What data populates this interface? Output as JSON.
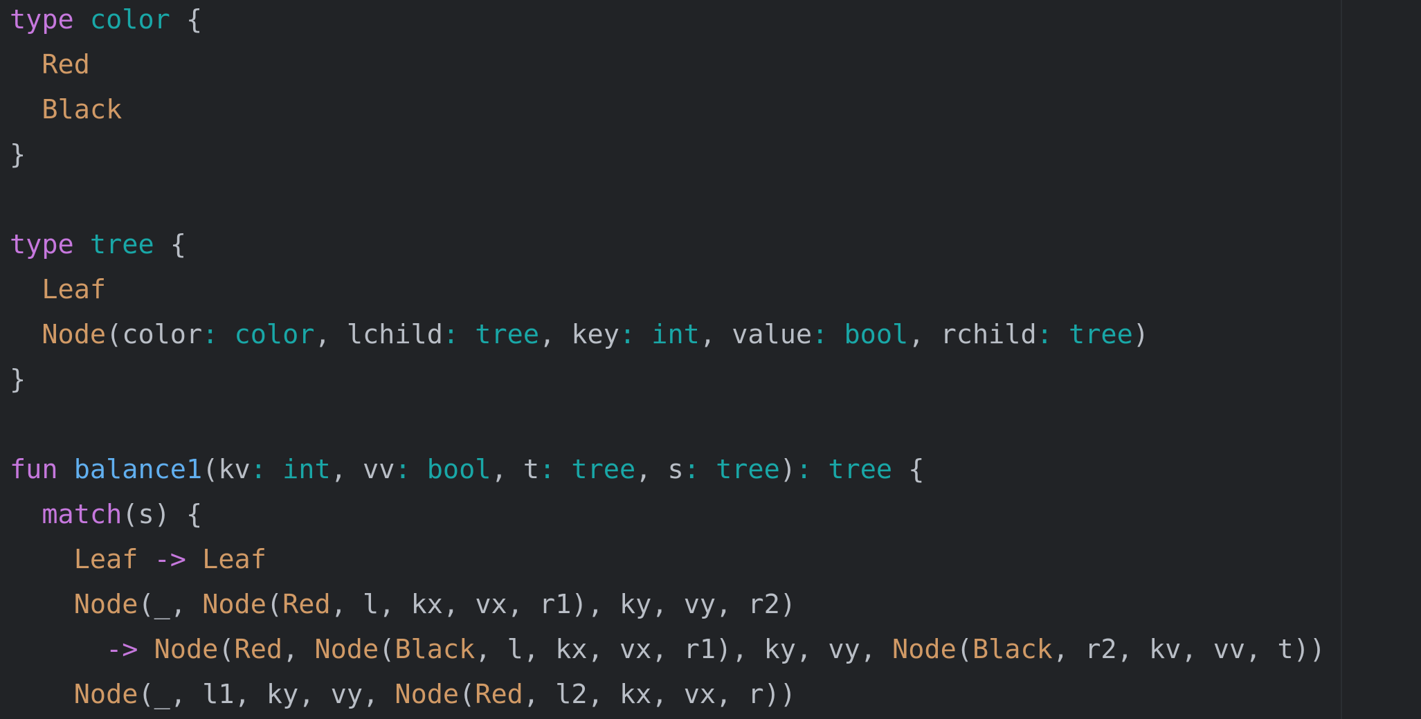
{
  "editor": {
    "colors": {
      "background": "#212326",
      "keyword": "#c678dd",
      "type": "#19a7a7",
      "constructor": "#d19a66",
      "function": "#61afef",
      "identifier": "#b9bec6"
    },
    "lines": [
      [
        [
          "kw",
          "type"
        ],
        [
          "ws",
          " "
        ],
        [
          "type",
          "color"
        ],
        [
          "ws",
          " "
        ],
        [
          "punc",
          "{"
        ]
      ],
      [
        [
          "ws",
          "  "
        ],
        [
          "ctor",
          "Red"
        ]
      ],
      [
        [
          "ws",
          "  "
        ],
        [
          "ctor",
          "Black"
        ]
      ],
      [
        [
          "punc",
          "}"
        ]
      ],
      [],
      [
        [
          "kw",
          "type"
        ],
        [
          "ws",
          " "
        ],
        [
          "type",
          "tree"
        ],
        [
          "ws",
          " "
        ],
        [
          "punc",
          "{"
        ]
      ],
      [
        [
          "ws",
          "  "
        ],
        [
          "ctor",
          "Leaf"
        ]
      ],
      [
        [
          "ws",
          "  "
        ],
        [
          "ctor",
          "Node"
        ],
        [
          "punc",
          "("
        ],
        [
          "id",
          "color"
        ],
        [
          "colon",
          ":"
        ],
        [
          "ws",
          " "
        ],
        [
          "type",
          "color"
        ],
        [
          "punc",
          ","
        ],
        [
          "ws",
          " "
        ],
        [
          "id",
          "lchild"
        ],
        [
          "colon",
          ":"
        ],
        [
          "ws",
          " "
        ],
        [
          "type",
          "tree"
        ],
        [
          "punc",
          ","
        ],
        [
          "ws",
          " "
        ],
        [
          "id",
          "key"
        ],
        [
          "colon",
          ":"
        ],
        [
          "ws",
          " "
        ],
        [
          "type",
          "int"
        ],
        [
          "punc",
          ","
        ],
        [
          "ws",
          " "
        ],
        [
          "id",
          "value"
        ],
        [
          "colon",
          ":"
        ],
        [
          "ws",
          " "
        ],
        [
          "type",
          "bool"
        ],
        [
          "punc",
          ","
        ],
        [
          "ws",
          " "
        ],
        [
          "id",
          "rchild"
        ],
        [
          "colon",
          ":"
        ],
        [
          "ws",
          " "
        ],
        [
          "type",
          "tree"
        ],
        [
          "punc",
          ")"
        ]
      ],
      [
        [
          "punc",
          "}"
        ]
      ],
      [],
      [
        [
          "kw",
          "fun"
        ],
        [
          "ws",
          " "
        ],
        [
          "fn",
          "balance1"
        ],
        [
          "punc",
          "("
        ],
        [
          "id",
          "kv"
        ],
        [
          "colon",
          ":"
        ],
        [
          "ws",
          " "
        ],
        [
          "type",
          "int"
        ],
        [
          "punc",
          ","
        ],
        [
          "ws",
          " "
        ],
        [
          "id",
          "vv"
        ],
        [
          "colon",
          ":"
        ],
        [
          "ws",
          " "
        ],
        [
          "type",
          "bool"
        ],
        [
          "punc",
          ","
        ],
        [
          "ws",
          " "
        ],
        [
          "id",
          "t"
        ],
        [
          "colon",
          ":"
        ],
        [
          "ws",
          " "
        ],
        [
          "type",
          "tree"
        ],
        [
          "punc",
          ","
        ],
        [
          "ws",
          " "
        ],
        [
          "id",
          "s"
        ],
        [
          "colon",
          ":"
        ],
        [
          "ws",
          " "
        ],
        [
          "type",
          "tree"
        ],
        [
          "punc",
          ")"
        ],
        [
          "colon",
          ":"
        ],
        [
          "ws",
          " "
        ],
        [
          "type",
          "tree"
        ],
        [
          "ws",
          " "
        ],
        [
          "punc",
          "{"
        ]
      ],
      [
        [
          "ws",
          "  "
        ],
        [
          "kw",
          "match"
        ],
        [
          "punc",
          "("
        ],
        [
          "id",
          "s"
        ],
        [
          "punc",
          ")"
        ],
        [
          "ws",
          " "
        ],
        [
          "punc",
          "{"
        ]
      ],
      [
        [
          "ws",
          "    "
        ],
        [
          "ctor",
          "Leaf"
        ],
        [
          "ws",
          " "
        ],
        [
          "op",
          "->"
        ],
        [
          "ws",
          " "
        ],
        [
          "ctor",
          "Leaf"
        ]
      ],
      [
        [
          "ws",
          "    "
        ],
        [
          "ctor",
          "Node"
        ],
        [
          "punc",
          "("
        ],
        [
          "id",
          "_"
        ],
        [
          "punc",
          ","
        ],
        [
          "ws",
          " "
        ],
        [
          "ctor",
          "Node"
        ],
        [
          "punc",
          "("
        ],
        [
          "ctor",
          "Red"
        ],
        [
          "punc",
          ","
        ],
        [
          "ws",
          " "
        ],
        [
          "id",
          "l"
        ],
        [
          "punc",
          ","
        ],
        [
          "ws",
          " "
        ],
        [
          "id",
          "kx"
        ],
        [
          "punc",
          ","
        ],
        [
          "ws",
          " "
        ],
        [
          "id",
          "vx"
        ],
        [
          "punc",
          ","
        ],
        [
          "ws",
          " "
        ],
        [
          "id",
          "r1"
        ],
        [
          "punc",
          "),"
        ],
        [
          "ws",
          " "
        ],
        [
          "id",
          "ky"
        ],
        [
          "punc",
          ","
        ],
        [
          "ws",
          " "
        ],
        [
          "id",
          "vy"
        ],
        [
          "punc",
          ","
        ],
        [
          "ws",
          " "
        ],
        [
          "id",
          "r2"
        ],
        [
          "punc",
          ")"
        ]
      ],
      [
        [
          "ws",
          "      "
        ],
        [
          "op",
          "->"
        ],
        [
          "ws",
          " "
        ],
        [
          "ctor",
          "Node"
        ],
        [
          "punc",
          "("
        ],
        [
          "ctor",
          "Red"
        ],
        [
          "punc",
          ","
        ],
        [
          "ws",
          " "
        ],
        [
          "ctor",
          "Node"
        ],
        [
          "punc",
          "("
        ],
        [
          "ctor",
          "Black"
        ],
        [
          "punc",
          ","
        ],
        [
          "ws",
          " "
        ],
        [
          "id",
          "l"
        ],
        [
          "punc",
          ","
        ],
        [
          "ws",
          " "
        ],
        [
          "id",
          "kx"
        ],
        [
          "punc",
          ","
        ],
        [
          "ws",
          " "
        ],
        [
          "id",
          "vx"
        ],
        [
          "punc",
          ","
        ],
        [
          "ws",
          " "
        ],
        [
          "id",
          "r1"
        ],
        [
          "punc",
          "),"
        ],
        [
          "ws",
          " "
        ],
        [
          "id",
          "ky"
        ],
        [
          "punc",
          ","
        ],
        [
          "ws",
          " "
        ],
        [
          "id",
          "vy"
        ],
        [
          "punc",
          ","
        ],
        [
          "ws",
          " "
        ],
        [
          "ctor",
          "Node"
        ],
        [
          "punc",
          "("
        ],
        [
          "ctor",
          "Black"
        ],
        [
          "punc",
          ","
        ],
        [
          "ws",
          " "
        ],
        [
          "id",
          "r2"
        ],
        [
          "punc",
          ","
        ],
        [
          "ws",
          " "
        ],
        [
          "id",
          "kv"
        ],
        [
          "punc",
          ","
        ],
        [
          "ws",
          " "
        ],
        [
          "id",
          "vv"
        ],
        [
          "punc",
          ","
        ],
        [
          "ws",
          " "
        ],
        [
          "id",
          "t"
        ],
        [
          "punc",
          "))"
        ]
      ],
      [
        [
          "ws",
          "    "
        ],
        [
          "ctor",
          "Node"
        ],
        [
          "punc",
          "("
        ],
        [
          "id",
          "_"
        ],
        [
          "punc",
          ","
        ],
        [
          "ws",
          " "
        ],
        [
          "id",
          "l1"
        ],
        [
          "punc",
          ","
        ],
        [
          "ws",
          " "
        ],
        [
          "id",
          "ky"
        ],
        [
          "punc",
          ","
        ],
        [
          "ws",
          " "
        ],
        [
          "id",
          "vy"
        ],
        [
          "punc",
          ","
        ],
        [
          "ws",
          " "
        ],
        [
          "ctor",
          "Node"
        ],
        [
          "punc",
          "("
        ],
        [
          "ctor",
          "Red"
        ],
        [
          "punc",
          ","
        ],
        [
          "ws",
          " "
        ],
        [
          "id",
          "l2"
        ],
        [
          "punc",
          ","
        ],
        [
          "ws",
          " "
        ],
        [
          "id",
          "kx"
        ],
        [
          "punc",
          ","
        ],
        [
          "ws",
          " "
        ],
        [
          "id",
          "vx"
        ],
        [
          "punc",
          ","
        ],
        [
          "ws",
          " "
        ],
        [
          "id",
          "r"
        ],
        [
          "punc",
          "))"
        ]
      ]
    ]
  }
}
